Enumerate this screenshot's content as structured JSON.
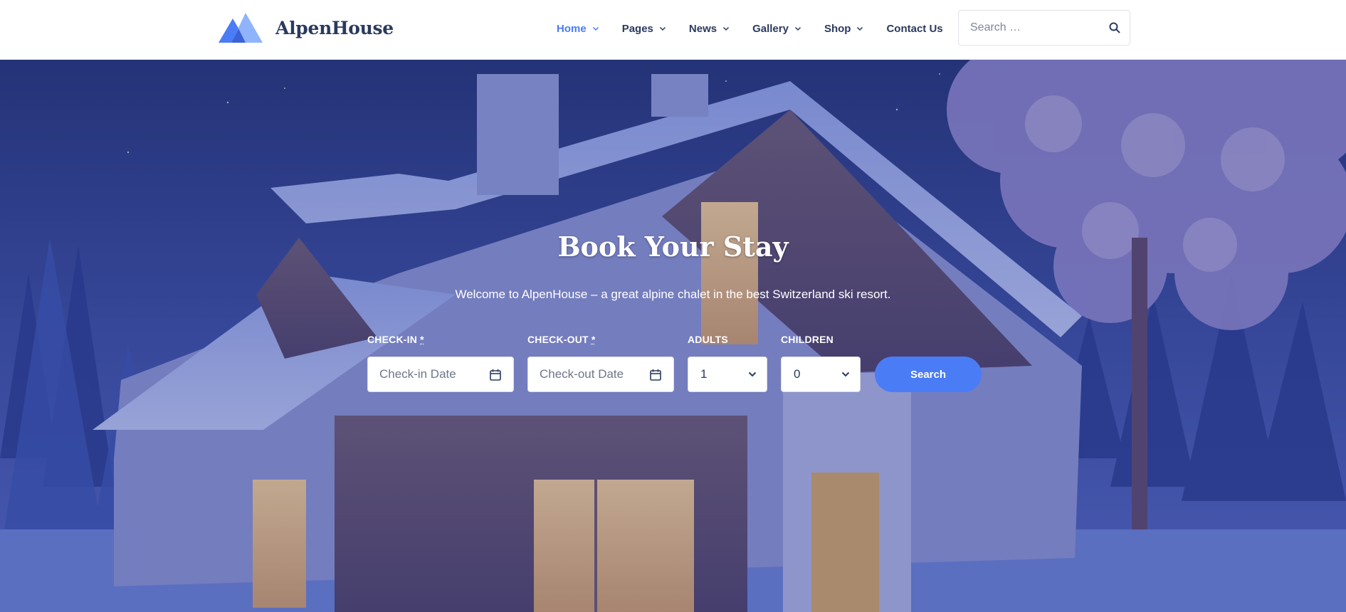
{
  "brand": {
    "name": "AlpenHouse",
    "accent": "#4a7cf6",
    "text_color": "#2a3a5e"
  },
  "nav": {
    "items": [
      {
        "label": "Home",
        "active": true,
        "has_dropdown": true
      },
      {
        "label": "Pages",
        "active": false,
        "has_dropdown": true
      },
      {
        "label": "News",
        "active": false,
        "has_dropdown": true
      },
      {
        "label": "Gallery",
        "active": false,
        "has_dropdown": true
      },
      {
        "label": "Shop",
        "active": false,
        "has_dropdown": true
      },
      {
        "label": "Contact Us",
        "active": false,
        "has_dropdown": false
      }
    ]
  },
  "search": {
    "placeholder": "Search …",
    "icon": "search-icon"
  },
  "hero": {
    "title": "Book Your Stay",
    "subtitle": "Welcome to AlpenHouse – a great alpine chalet in the best Switzerland ski resort."
  },
  "booking": {
    "checkin": {
      "label": "CHECK-IN",
      "required_mark": "*",
      "placeholder": "Check-in Date",
      "icon": "calendar-icon"
    },
    "checkout": {
      "label": "CHECK-OUT",
      "required_mark": "*",
      "placeholder": "Check-out Date",
      "icon": "calendar-icon"
    },
    "adults": {
      "label": "ADULTS",
      "value": "1",
      "icon": "chevron-down-icon"
    },
    "children": {
      "label": "CHILDREN",
      "value": "0",
      "icon": "chevron-down-icon"
    },
    "submit_label": "Search"
  }
}
